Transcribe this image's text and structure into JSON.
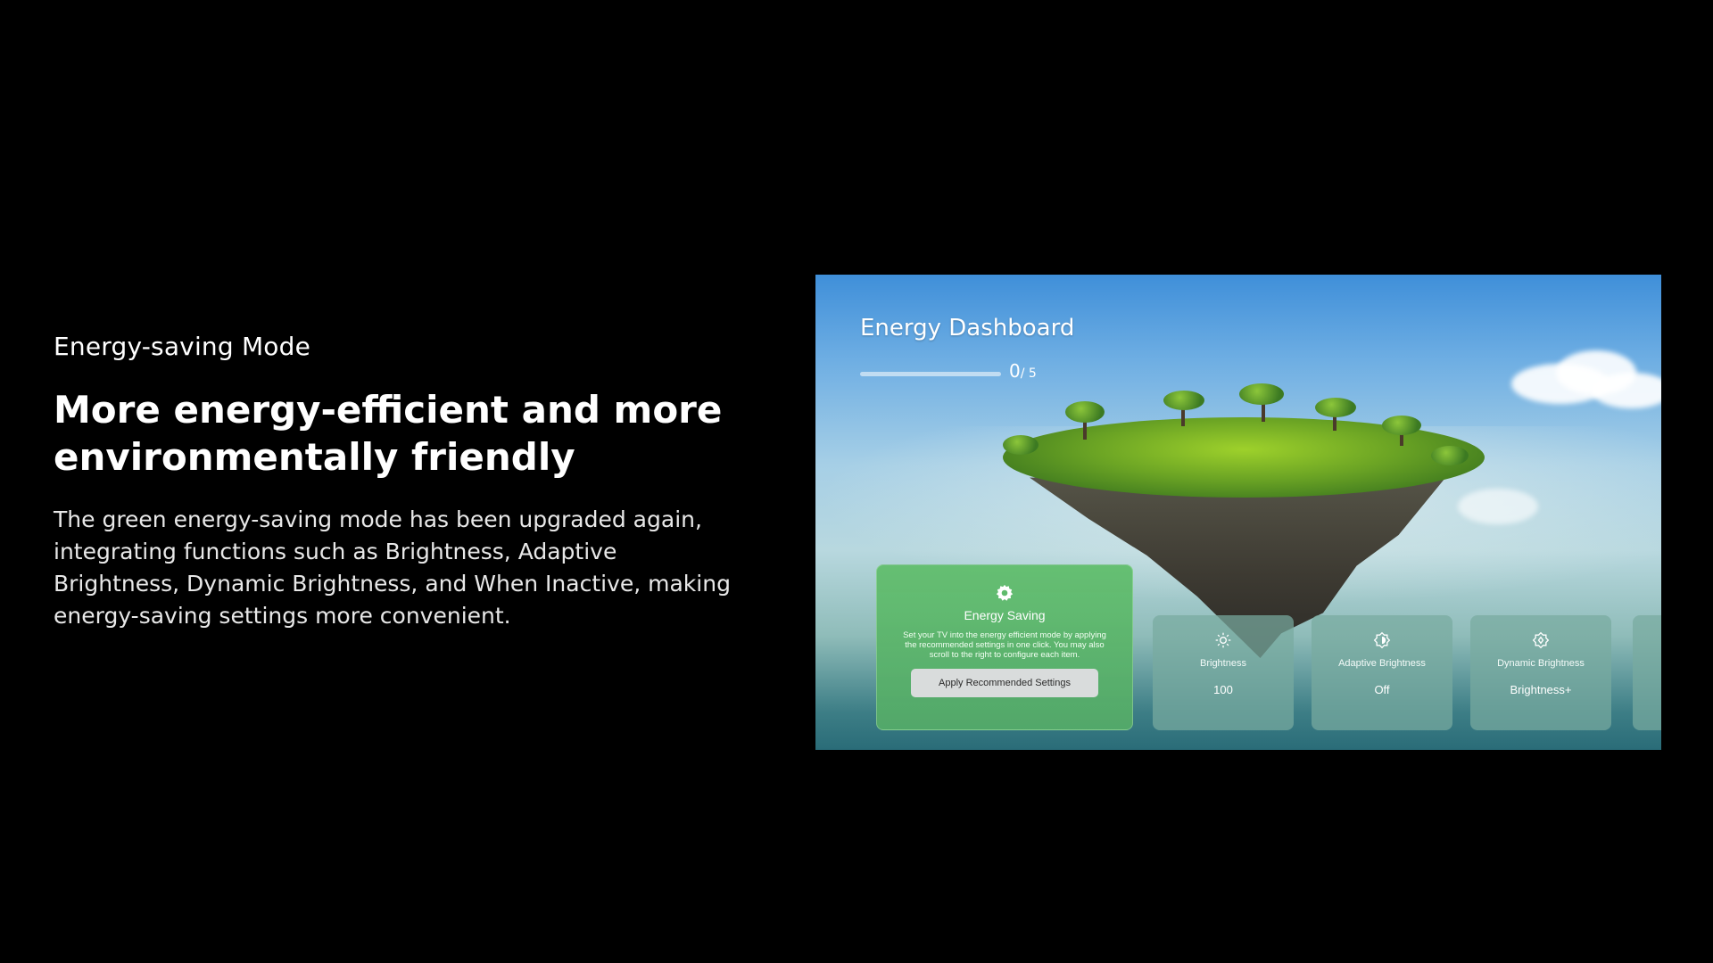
{
  "copy": {
    "eyebrow": "Energy-saving Mode",
    "headline": "More energy-efficient and more environmentally friendly",
    "body": "The green energy-saving mode has been upgraded again, integrating functions such as Brightness, Adaptive Brightness, Dynamic Brightness, and When Inactive, making energy-saving settings more convenient."
  },
  "dashboard": {
    "title": "Energy Dashboard",
    "progress_current": "0",
    "progress_total": "/ 5",
    "progress_fraction": 0,
    "main_card": {
      "icon": "gear-icon",
      "title": "Energy Saving",
      "description": "Set your TV into the energy efficient mode by applying the recommended settings in one click. You may also scroll to the right to configure each item.",
      "button_label": "Apply Recommended Settings"
    },
    "cards": [
      {
        "icon": "sun-icon",
        "label": "Brightness",
        "value": "100"
      },
      {
        "icon": "adaptive-brightness-icon",
        "label": "Adaptive Brightness",
        "value": "Off"
      },
      {
        "icon": "dynamic-brightness-icon",
        "label": "Dynamic Brightness",
        "value": "Brightness+"
      }
    ]
  },
  "colors": {
    "page_background": "#000000",
    "main_card": "#5fbb6c",
    "setting_card": "#78aaa0",
    "button": "#d9dcdc"
  }
}
